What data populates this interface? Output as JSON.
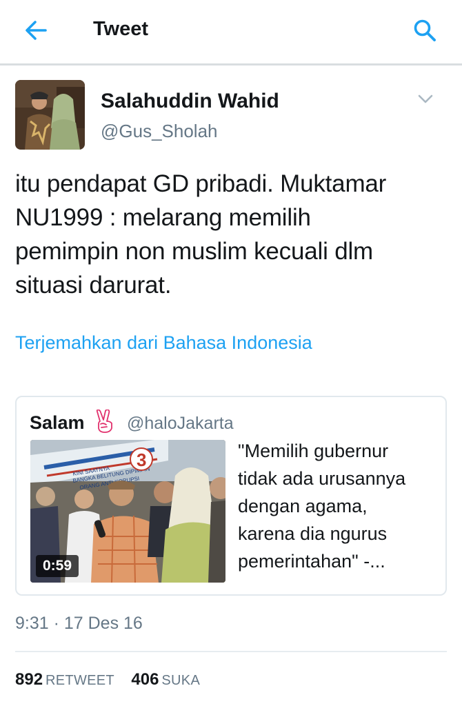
{
  "header": {
    "title": "Tweet",
    "back_icon": "arrow-left-icon",
    "search_icon": "search-icon",
    "accent_color": "#1da1f2"
  },
  "tweet": {
    "author": {
      "name": "Salahuddin Wahid",
      "handle": "@Gus_Sholah"
    },
    "text_lines": [
      "itu pendapat GD pribadi. Muktamar",
      "NU1999 : melarang memilih",
      "pemimpin non muslim kecuali dlm",
      "situasi darurat."
    ],
    "translate_link": "Terjemahkan dari Bahasa Indonesia",
    "timestamp": "9:31 · 17 Des 16"
  },
  "quoted_tweet": {
    "name": "Salam",
    "emoji_icon": "victory-hand-icon",
    "handle": "@haloJakarta",
    "video_duration": "0:59",
    "text_lines": [
      "\"Memilih gubernur",
      "tidak ada urusannya",
      "dengan agama,",
      "karena dia ngurus",
      "pemerintahan\" -..."
    ]
  },
  "stats": {
    "retweets": "892",
    "retweets_label": "RETWEET",
    "likes": "406",
    "likes_label": "SUKA"
  }
}
